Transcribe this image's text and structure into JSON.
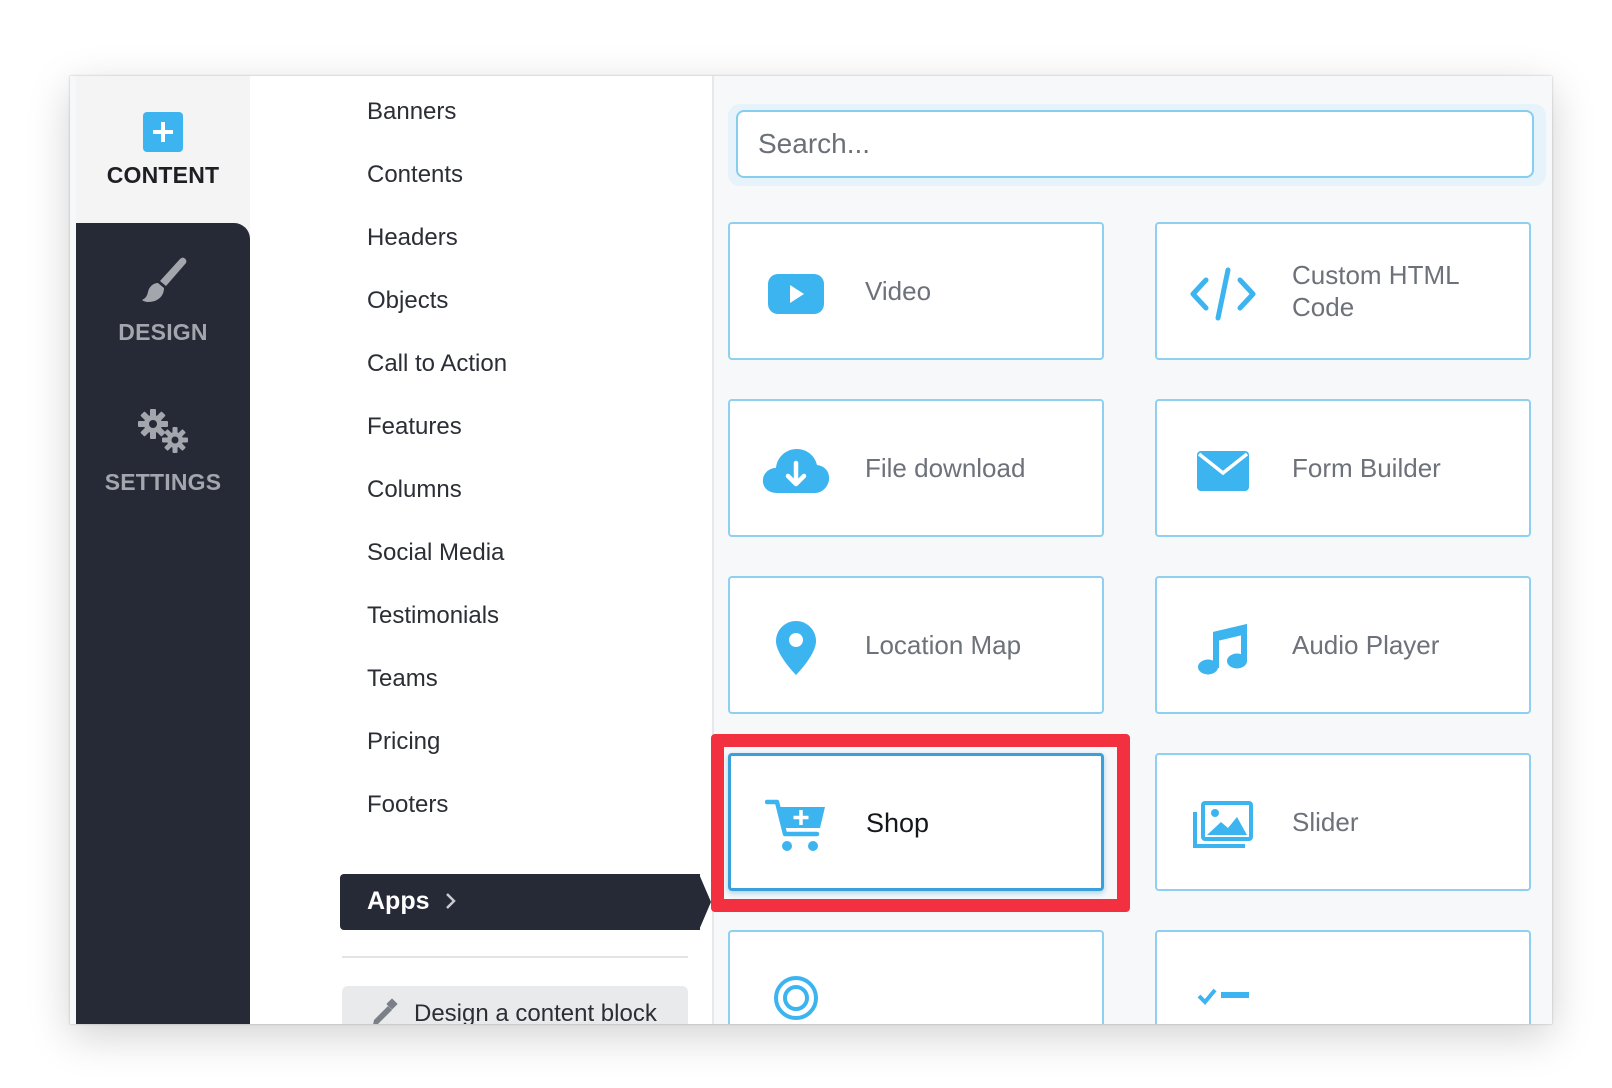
{
  "rail": {
    "content_label": "CONTENT",
    "design_label": "DESIGN",
    "settings_label": "SETTINGS"
  },
  "menu": {
    "items": [
      "Banners",
      "Contents",
      "Headers",
      "Objects",
      "Call to Action",
      "Features",
      "Columns",
      "Social Media",
      "Testimonials",
      "Teams",
      "Pricing",
      "Footers"
    ],
    "active_label": "Apps",
    "design_block_label": "Design a content block"
  },
  "search": {
    "placeholder": "Search..."
  },
  "apps": [
    {
      "label": "Video",
      "icon": "video-icon"
    },
    {
      "label": "Custom HTML Code",
      "icon": "code-icon"
    },
    {
      "label": "File download",
      "icon": "cloud-download-icon"
    },
    {
      "label": "Form Builder",
      "icon": "envelope-icon"
    },
    {
      "label": "Location Map",
      "icon": "map-pin-icon"
    },
    {
      "label": "Audio Player",
      "icon": "music-note-icon"
    },
    {
      "label": "Shop",
      "icon": "cart-plus-icon"
    },
    {
      "label": "Slider",
      "icon": "images-icon"
    }
  ],
  "colors": {
    "accent": "#3cb4f0",
    "dark": "#262a36",
    "highlight": "#f2303f"
  }
}
